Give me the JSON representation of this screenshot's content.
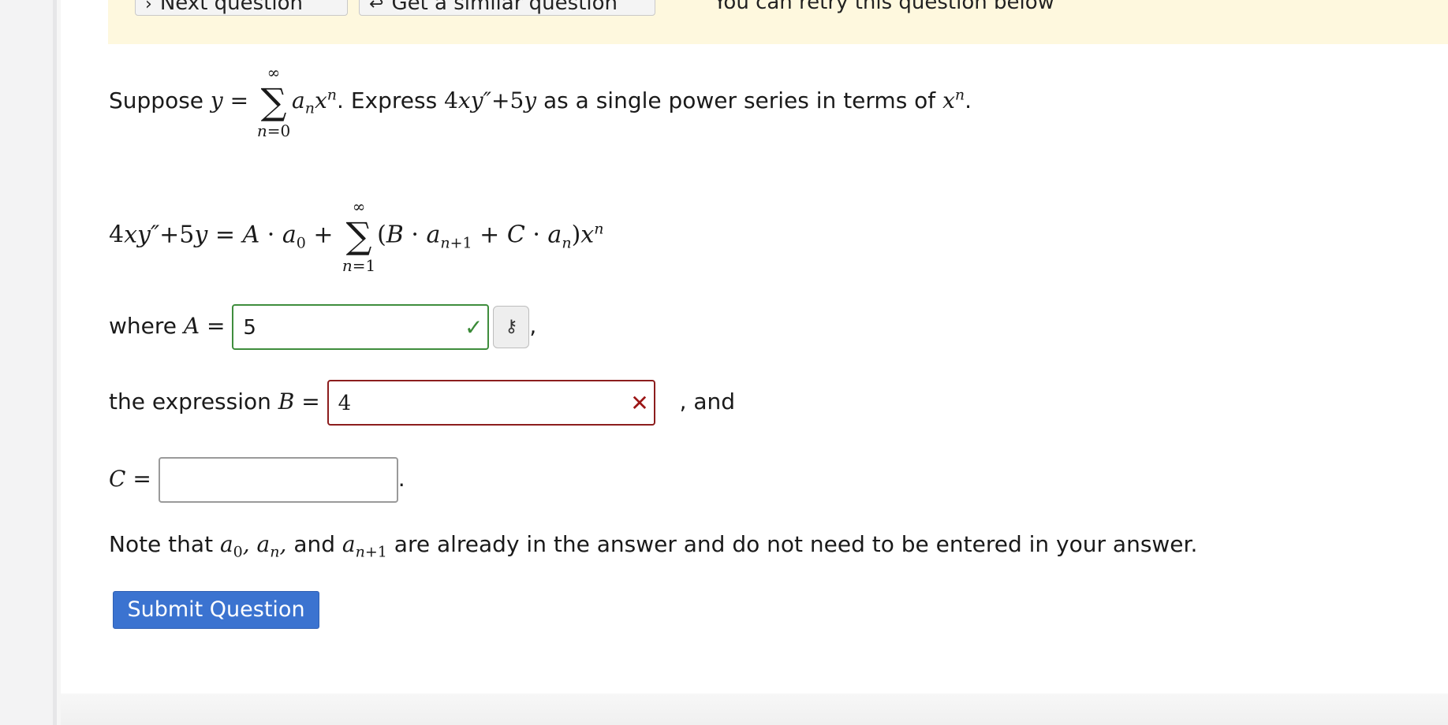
{
  "banner": {
    "next_label": "Next question",
    "similar_label": "Get a similar question",
    "retry_text": "You can retry this question below"
  },
  "question": {
    "suppose_prefix": "Suppose",
    "express_text": "Express",
    "suffix_text": "as a single power series in terms of"
  },
  "answer": {
    "where_text": "where",
    "A_value": "5",
    "the_expression_text": "the expression",
    "B_value": "4",
    "and_text": ", and",
    "C_value": ""
  },
  "note": {
    "prefix": "Note that",
    "and_word": "and",
    "suffix": "are already in the answer and do not need to be entered in your answer."
  },
  "submit_label": "Submit Question",
  "colors": {
    "correct": "#3f8d3d",
    "incorrect": "#8c1d1d",
    "submit": "#3b73d0",
    "banner": "#fef8de"
  }
}
